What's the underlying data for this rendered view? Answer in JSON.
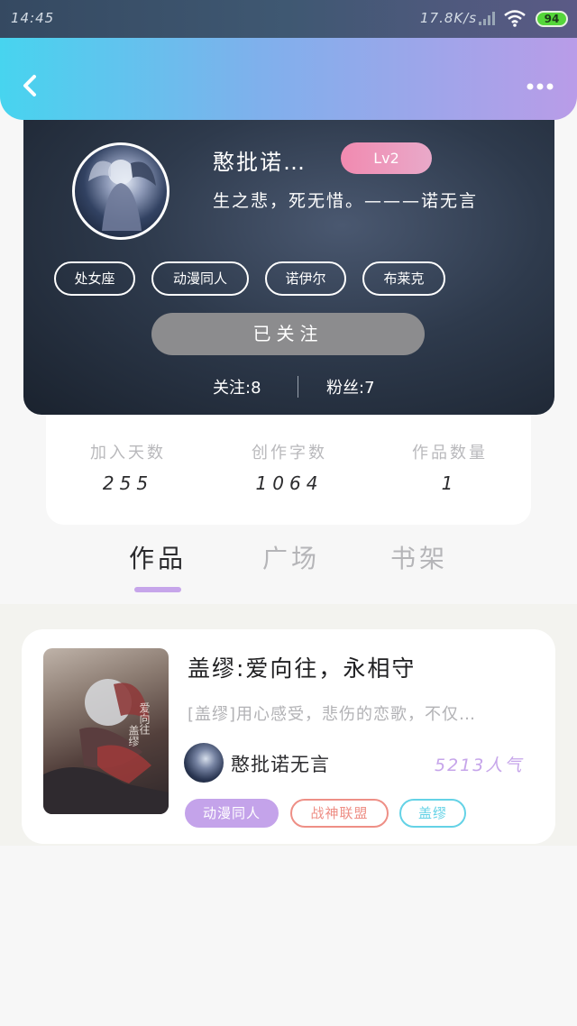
{
  "status_bar": {
    "time": "14:45",
    "network_speed": "17.8K/s",
    "battery": "94",
    "icons": [
      "signal-icon",
      "wifi-icon",
      "battery-icon"
    ]
  },
  "nav": {
    "back_icon": "chevron-left-icon",
    "more_icon": "more-dots-icon"
  },
  "profile": {
    "username": "憨批诺…",
    "level": "Lv2",
    "bio": "生之悲，死无惜。———诺无言",
    "tags": [
      "处女座",
      "动漫同人",
      "诺伊尔",
      "布莱克"
    ],
    "follow_button": "已关注",
    "following_label": "关注:8",
    "fans_label": "粉丝:7"
  },
  "stats": [
    {
      "label": "加入天数",
      "value": "255"
    },
    {
      "label": "创作字数",
      "value": "1064"
    },
    {
      "label": "作品数量",
      "value": "1"
    }
  ],
  "tabs": [
    {
      "label": "作品",
      "active": true
    },
    {
      "label": "广场",
      "active": false
    },
    {
      "label": "书架",
      "active": false
    }
  ],
  "works": [
    {
      "title": "盖缪:爱向往，永相守",
      "description": "[盖缪]用心感受，悲伤的恋歌，不仅…",
      "author": "憨批诺无言",
      "popularity": "5213人气",
      "tags": [
        "动漫同人",
        "战神联盟",
        "盖缪"
      ]
    }
  ],
  "colors": {
    "accent_purple": "#c6a5ea",
    "tag_red": "#ee8f86",
    "tag_cyan": "#64d2e6",
    "level_pink": "#f18ab0"
  }
}
